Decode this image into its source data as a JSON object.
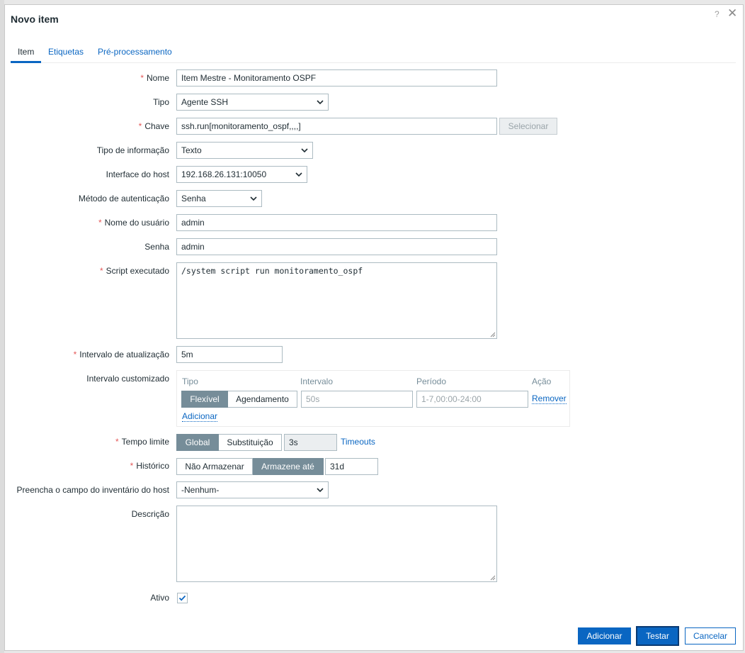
{
  "dialog": {
    "title": "Novo item",
    "help": "?",
    "close": "✕"
  },
  "tabs": [
    "Item",
    "Etiquetas",
    "Pré-processamento"
  ],
  "fields": {
    "name": {
      "label": "Nome",
      "value": "Item Mestre - Monitoramento OSPF",
      "required": true
    },
    "type": {
      "label": "Tipo",
      "value": "Agente SSH"
    },
    "key": {
      "label": "Chave",
      "value": "ssh.run[monitoramento_ospf,,,,]",
      "select_button": "Selecionar",
      "required": true
    },
    "info_type": {
      "label": "Tipo de informação",
      "value": "Texto"
    },
    "host_interface": {
      "label": "Interface do host",
      "value": "192.168.26.131:10050"
    },
    "auth_method": {
      "label": "Método de autenticação",
      "value": "Senha"
    },
    "username": {
      "label": "Nome do usuário",
      "value": "admin",
      "required": true
    },
    "password": {
      "label": "Senha",
      "value": "admin"
    },
    "script": {
      "label": "Script executado",
      "value": "/system script run monitoramento_ospf",
      "required": true
    },
    "update_interval": {
      "label": "Intervalo de atualização",
      "value": "5m",
      "required": true
    },
    "custom_intervals": {
      "label": "Intervalo customizado",
      "headers": [
        "Tipo",
        "Intervalo",
        "Período",
        "Ação"
      ],
      "row": {
        "type_options": [
          "Flexível",
          "Agendamento"
        ],
        "selected_type": "Flexível",
        "interval_placeholder": "50s",
        "period_placeholder": "1-7,00:00-24:00",
        "remove": "Remover"
      },
      "add": "Adicionar"
    },
    "timeout": {
      "label": "Tempo limite",
      "options": [
        "Global",
        "Substituição"
      ],
      "selected": "Global",
      "value": "3s",
      "link": "Timeouts",
      "required": true
    },
    "history": {
      "label": "Histórico",
      "options": [
        "Não Armazenar",
        "Armazene até"
      ],
      "selected": "Armazene até",
      "value": "31d",
      "required": true
    },
    "inventory": {
      "label": "Preencha o campo do inventário do host",
      "value": "-Nenhum-"
    },
    "description": {
      "label": "Descrição",
      "value": ""
    },
    "enabled": {
      "label": "Ativo",
      "checked": true
    }
  },
  "footer": {
    "add": "Adicionar",
    "test": "Testar",
    "cancel": "Cancelar"
  },
  "colors": {
    "accent": "#0a66c2",
    "required": "#e45959",
    "segment_on": "#768d99",
    "border": "#acbbc2"
  }
}
